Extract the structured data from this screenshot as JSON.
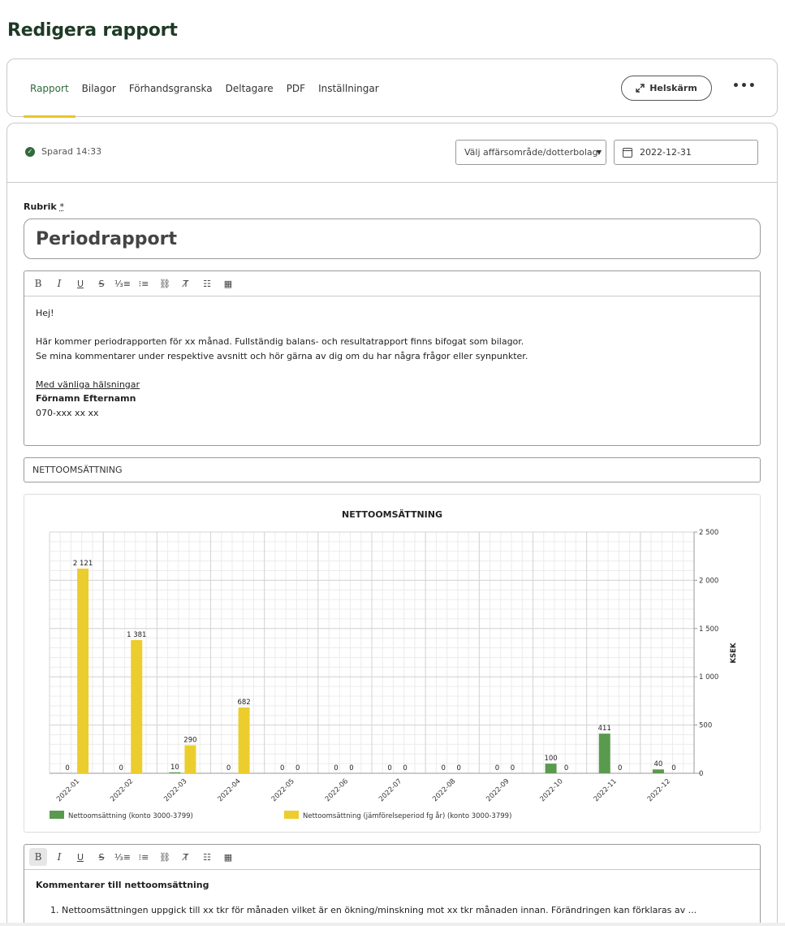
{
  "page": {
    "title": "Redigera rapport"
  },
  "tabs": [
    {
      "label": "Rapport",
      "active": true
    },
    {
      "label": "Bilagor",
      "active": false
    },
    {
      "label": "Förhandsgranska",
      "active": false
    },
    {
      "label": "Deltagare",
      "active": false
    },
    {
      "label": "PDF",
      "active": false
    },
    {
      "label": "Inställningar",
      "active": false
    }
  ],
  "header_actions": {
    "fullscreen_label": "Helskärm",
    "more_label": "•••"
  },
  "status": {
    "saved_text": "Sparad 14:33"
  },
  "filters": {
    "business_area_placeholder": "Välj affärsområde/dotterbolag",
    "date_value": "2022-12-31"
  },
  "form": {
    "title_label": "Rubrik",
    "required_marker": "*",
    "title_value": "Periodrapport"
  },
  "editor": {
    "greeting": "Hej!",
    "line1": "Här kommer periodrapporten för xx månad. Fullständig balans- och resultatrapport finns bifogat som bilagor.",
    "line2": "Se mina kommentarer under respektive avsnitt och hör gärna av dig om du har några frågor eller synpunkter.",
    "closing": "Med vänliga hälsningar",
    "name": "Förnamn Efternamn",
    "phone": "070-xxx xx xx"
  },
  "section": {
    "title_value": "NETTOOMSÄTTNING"
  },
  "chart_data": {
    "type": "bar",
    "title": "NETTOOMSÄTTNING",
    "ylabel": "KSEK",
    "ylim": [
      0,
      2500
    ],
    "yticks": [
      0,
      500,
      1000,
      1500,
      2000,
      2500
    ],
    "ytick_labels": [
      "0",
      "500",
      "1 000",
      "1 500",
      "2 000",
      "2 500"
    ],
    "y_axis_side": "right",
    "grid": true,
    "legend_position": "bottom-left",
    "categories": [
      "2022-01",
      "2022-02",
      "2022-03",
      "2022-04",
      "2022-05",
      "2022-06",
      "2022-07",
      "2022-08",
      "2022-09",
      "2022-10",
      "2022-11",
      "2022-12"
    ],
    "series": [
      {
        "name": "Nettoomsättning (konto 3000-3799)",
        "color": "#5a9a4e",
        "values": [
          0,
          0,
          10,
          0,
          0,
          0,
          0,
          0,
          0,
          100,
          411,
          40
        ],
        "labels": [
          "0",
          "0",
          "10",
          "0",
          "0",
          "0",
          "0",
          "0",
          "0",
          "100",
          "411",
          "40"
        ]
      },
      {
        "name": "Nettoomsättning (jämförelseperiod fg år) (konto 3000-3799)",
        "color": "#eccd2e",
        "values": [
          2121,
          1381,
          290,
          682,
          0,
          0,
          0,
          0,
          0,
          0,
          0,
          0
        ],
        "labels": [
          "2 121",
          "1 381",
          "290",
          "682",
          "0",
          "0",
          "0",
          "0",
          "0",
          "0",
          "0",
          "0"
        ]
      }
    ]
  },
  "comments": {
    "heading": "Kommentarer till nettoomsättning",
    "items": [
      "Nettoomsättningen uppgick till xx tkr för månaden vilket är en ökning/minskning mot xx tkr månaden innan. Förändringen kan förklaras av ..."
    ]
  },
  "toolbar_icons": [
    "bold-icon",
    "italic-icon",
    "underline-icon",
    "strikethrough-icon",
    "ordered-list-icon",
    "bullet-list-icon",
    "link-icon",
    "clear-format-icon",
    "columns-icon",
    "table-icon"
  ]
}
